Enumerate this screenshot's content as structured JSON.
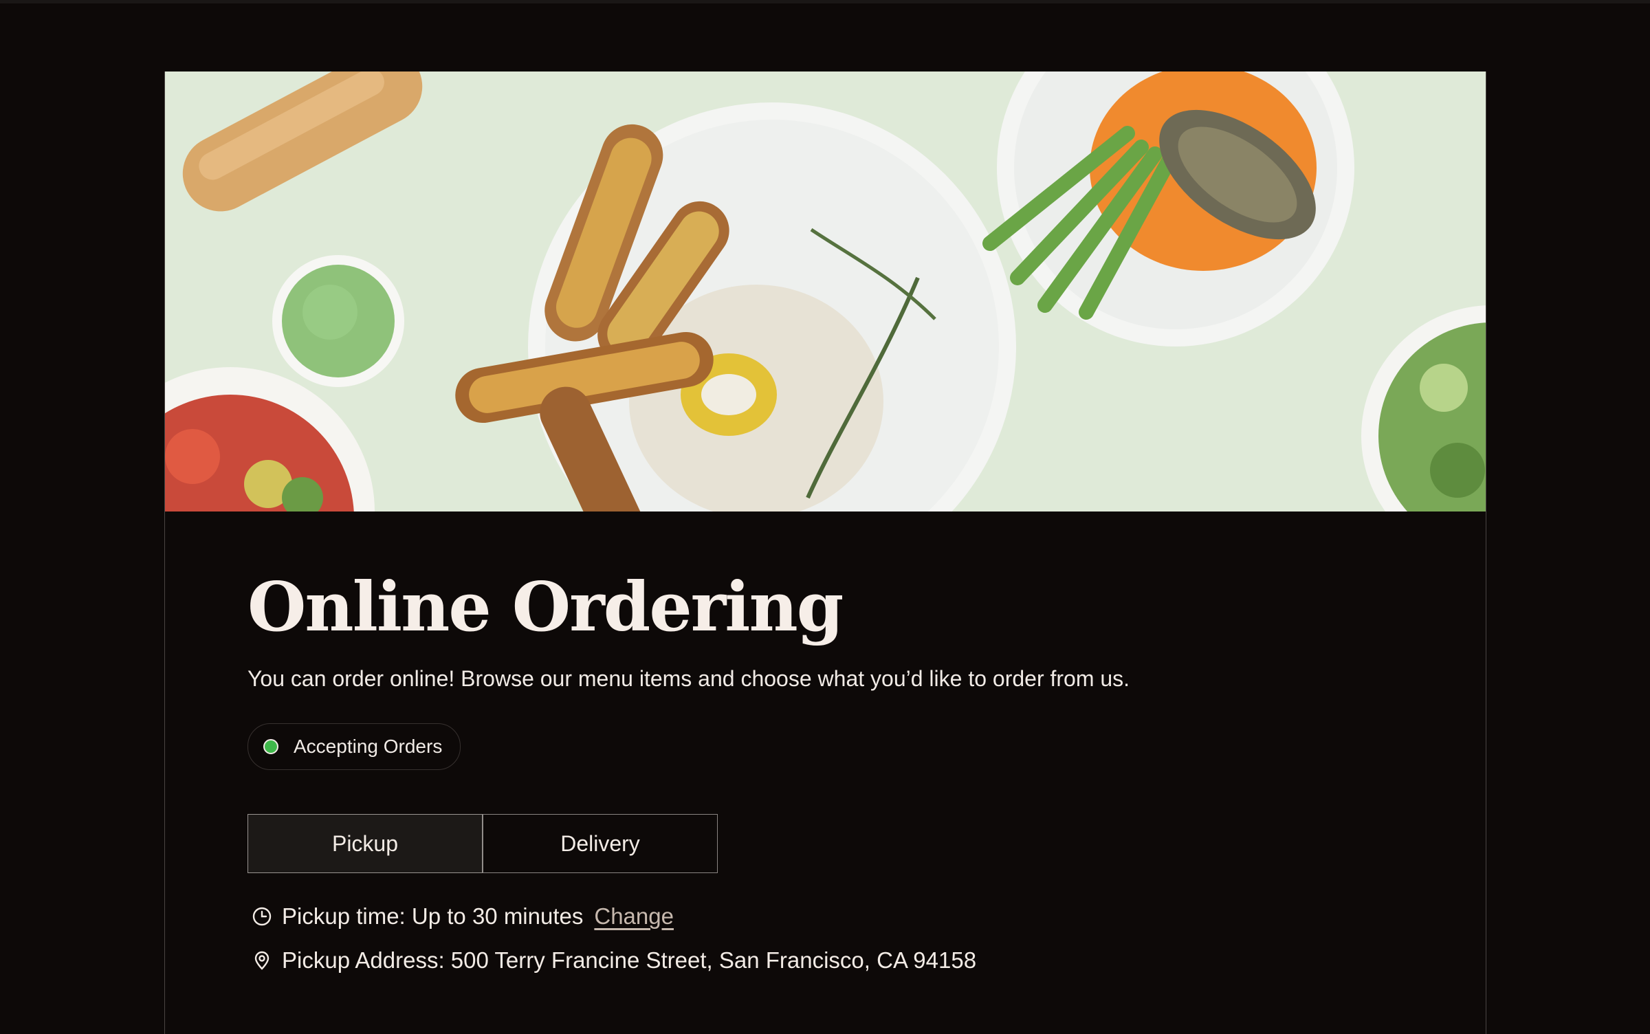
{
  "page": {
    "title": "Online Ordering",
    "subtitle": "You can order online! Browse our menu items and choose what you’d like to order from us."
  },
  "status": {
    "label": "Accepting Orders",
    "color": "#3fb84b"
  },
  "order_modes": {
    "pickup_label": "Pickup",
    "delivery_label": "Delivery",
    "selected": "Pickup"
  },
  "pickup": {
    "time_label": "Pickup time: Up to 30 minutes",
    "change_label": "Change",
    "address_label": "Pickup Address: 500 Terry Francine Street, San Francisco, CA 94158"
  },
  "icons": {
    "clock": "clock-icon",
    "location": "location-pin-icon"
  },
  "colors": {
    "background": "#0d0908",
    "text": "#f3ece6",
    "hero_background": "#dfead8",
    "accent_link": "#c7b9ae"
  }
}
